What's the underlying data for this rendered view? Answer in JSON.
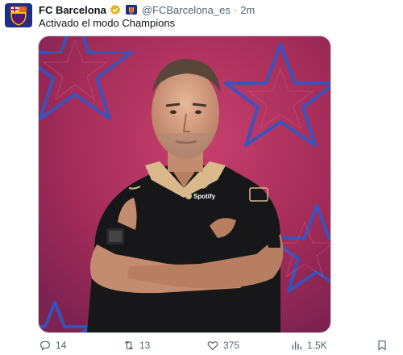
{
  "tweet": {
    "author_name": "FC Barcelona",
    "handle": "@FCBarcelona_es",
    "separator": "·",
    "time": "2m",
    "text": "Activado el modo Champions"
  },
  "media": {
    "alt": "Player portrait on pink starry background",
    "shirt_sponsor": "Spotify",
    "background_color": "#b0305a",
    "star_color": "#2f57c8"
  },
  "actions": {
    "replies": "14",
    "retweets": "13",
    "likes": "375",
    "views": "1.5K"
  },
  "colors": {
    "text_primary": "#0f1419",
    "text_secondary": "#536471",
    "verified_gold": "#e8b428"
  }
}
